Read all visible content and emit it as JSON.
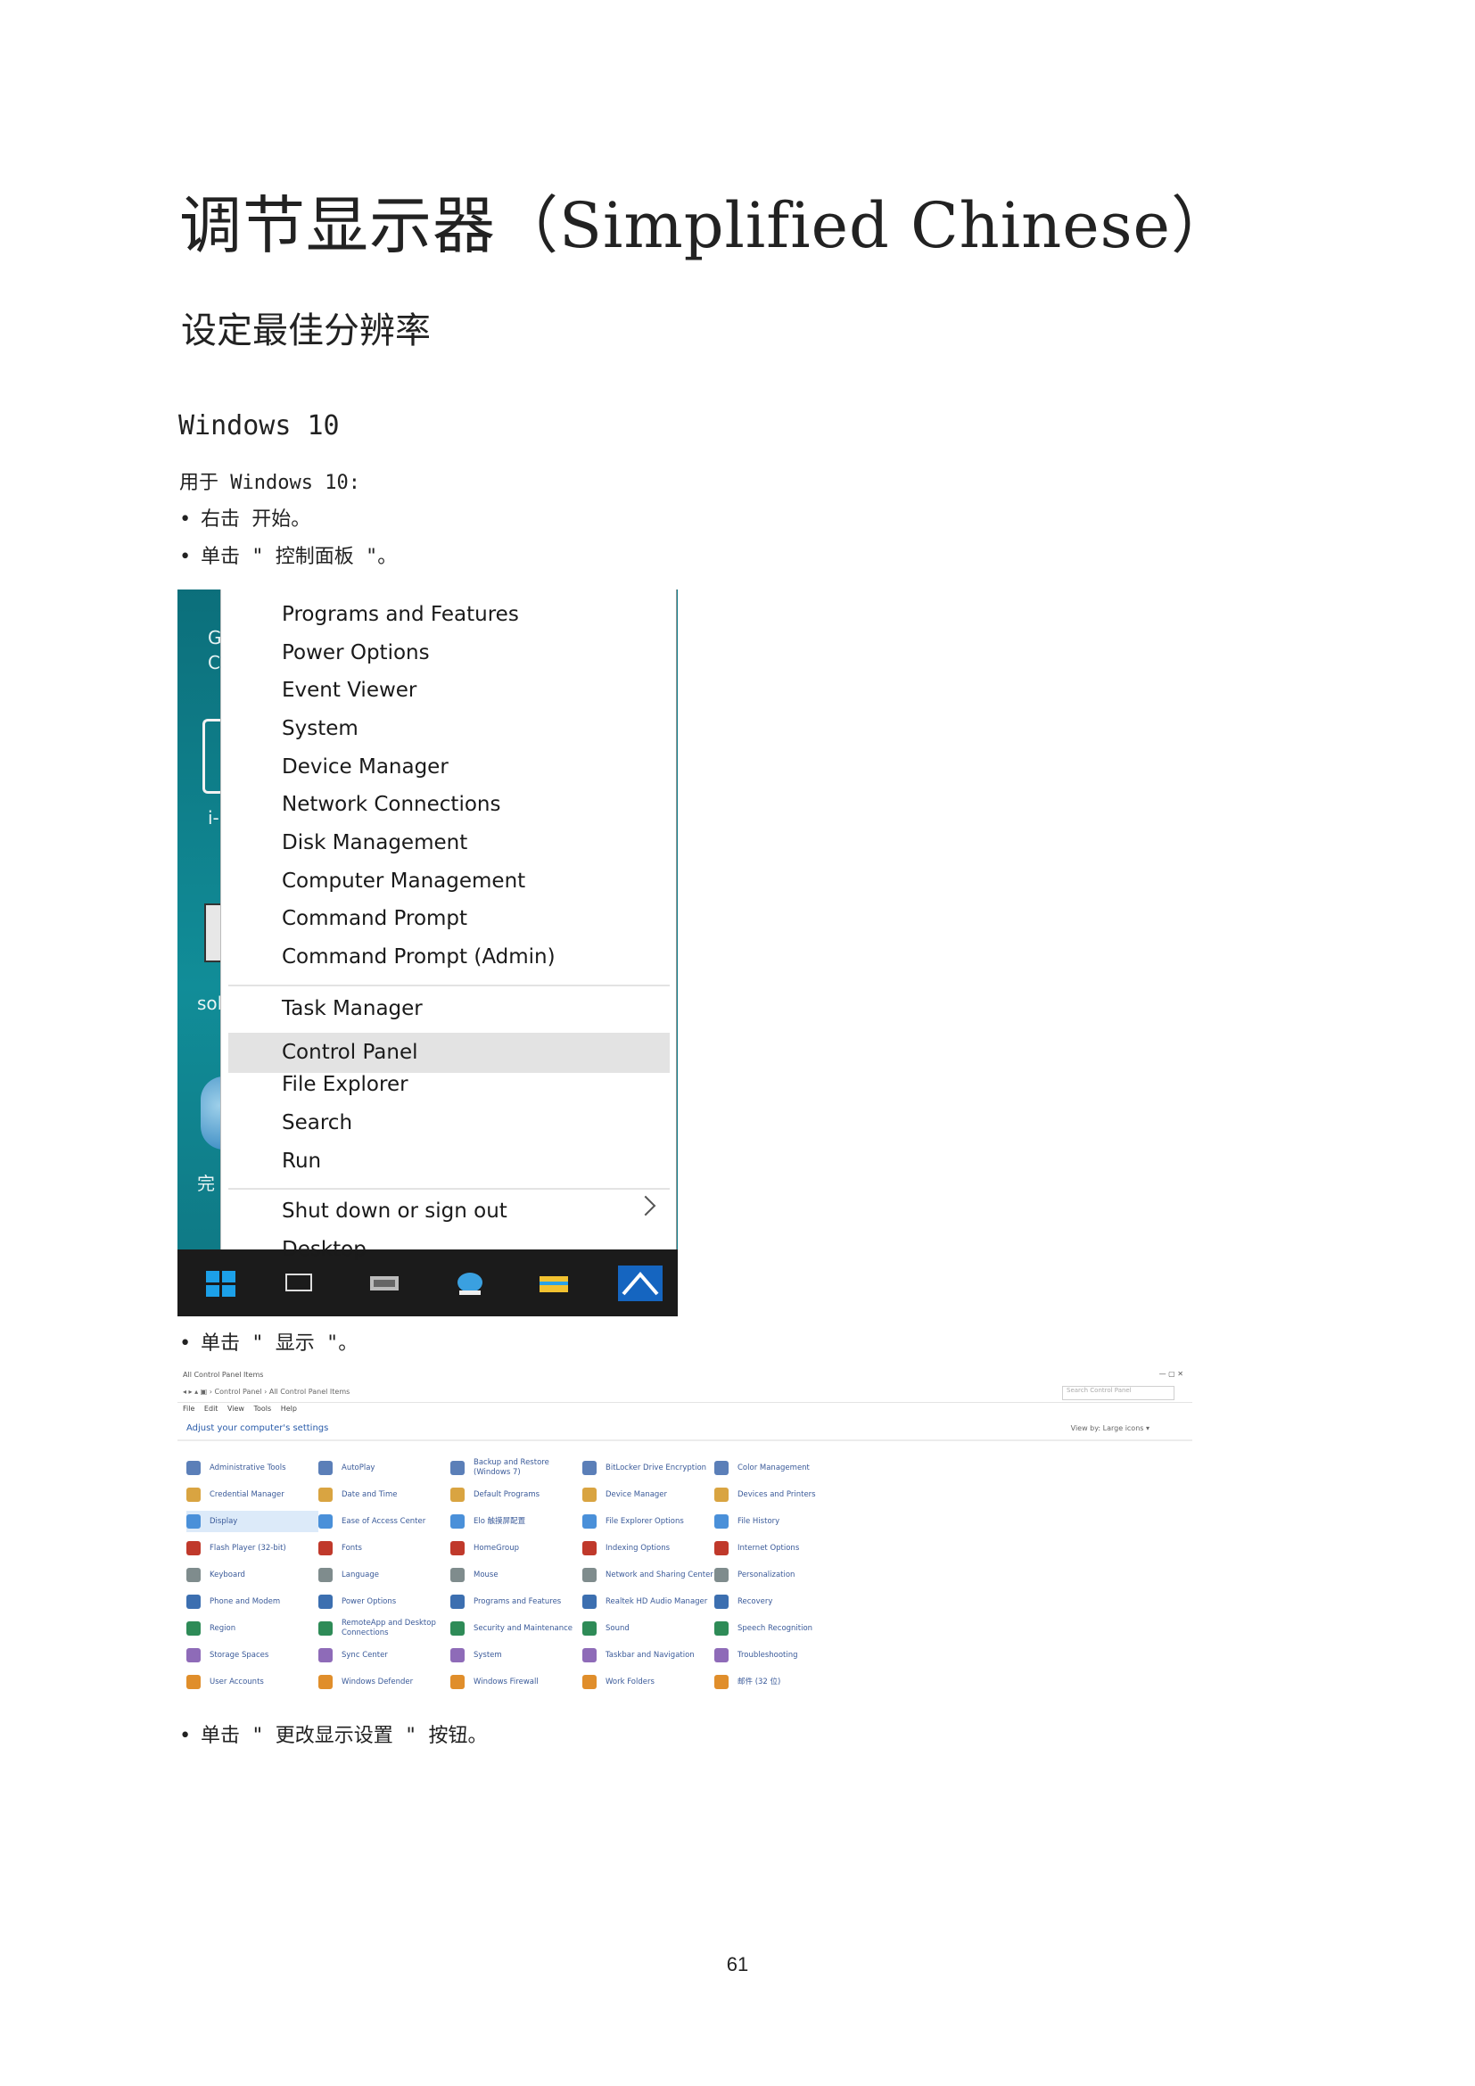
{
  "title": "调节显示器（Simplified Chinese）",
  "subtitle": "设定最佳分辨率",
  "os_heading": "Windows 10",
  "intro": "用于 Windows 10:",
  "steps": [
    "右击 开始。",
    "单击 \" 控制面板 \"。",
    "单击 \" 显示 \"。",
    "单击 \" 更改显示设置 \" 按钮。"
  ],
  "bullet": "•",
  "winx_menu": {
    "desk_glyphs": [
      "G",
      "C",
      "i-",
      "sol",
      "完"
    ],
    "items": [
      "Programs and Features",
      "Power Options",
      "Event Viewer",
      "System",
      "Device Manager",
      "Network Connections",
      "Disk Management",
      "Computer Management",
      "Command Prompt",
      "Command Prompt (Admin)",
      "Task Manager",
      "Control Panel",
      "File Explorer",
      "Search",
      "Run",
      "Shut down or sign out",
      "Desktop"
    ],
    "highlighted": "Control Panel",
    "colors": {
      "desktop": "#107e8a",
      "taskbar": "#1b1b1b",
      "highlight": "#e3e3e3",
      "start": "#1ca0e8"
    }
  },
  "control_panel": {
    "window_title": "All Control Panel Items",
    "address": "◂ ▸ ▴  ▣ › Control Panel › All Control Panel Items",
    "search_placeholder": "Search Control Panel",
    "window_buttons": "—   ▢   ✕",
    "menu_bar": "File Edit View Tools Help",
    "heading": "Adjust your computer's settings",
    "view_by": "View by:  Large icons ▾",
    "columns": [
      [
        "Administrative Tools",
        "Credential Manager",
        "Display",
        "Flash Player (32-bit)",
        "Keyboard",
        "Phone and Modem",
        "Region",
        "Storage Spaces",
        "User Accounts"
      ],
      [
        "AutoPlay",
        "Date and Time",
        "Ease of Access Center",
        "Fonts",
        "Language",
        "Power Options",
        "RemoteApp and Desktop Connections",
        "Sync Center",
        "Windows Defender"
      ],
      [
        "Backup and Restore (Windows 7)",
        "Default Programs",
        "Elo 触摸屏配置",
        "HomeGroup",
        "Mouse",
        "Programs and Features",
        "Security and Maintenance",
        "System",
        "Windows Firewall"
      ],
      [
        "BitLocker Drive Encryption",
        "Device Manager",
        "File Explorer Options",
        "Indexing Options",
        "Network and Sharing Center",
        "Realtek HD Audio Manager",
        "Sound",
        "Taskbar and Navigation",
        "Work Folders"
      ],
      [
        "Color Management",
        "Devices and Printers",
        "File History",
        "Internet Options",
        "Personalization",
        "Recovery",
        "Speech Recognition",
        "Troubleshooting",
        "邮件 (32 位)"
      ]
    ],
    "selected": "Display",
    "icon_colors": [
      "#5b7fb8",
      "#d9a441",
      "#4a90d9",
      "#c0392b",
      "#7f8c8d",
      "#3c6fb0",
      "#2e8b57",
      "#8e6bb8",
      "#e08e2b"
    ]
  },
  "page_number": "61"
}
